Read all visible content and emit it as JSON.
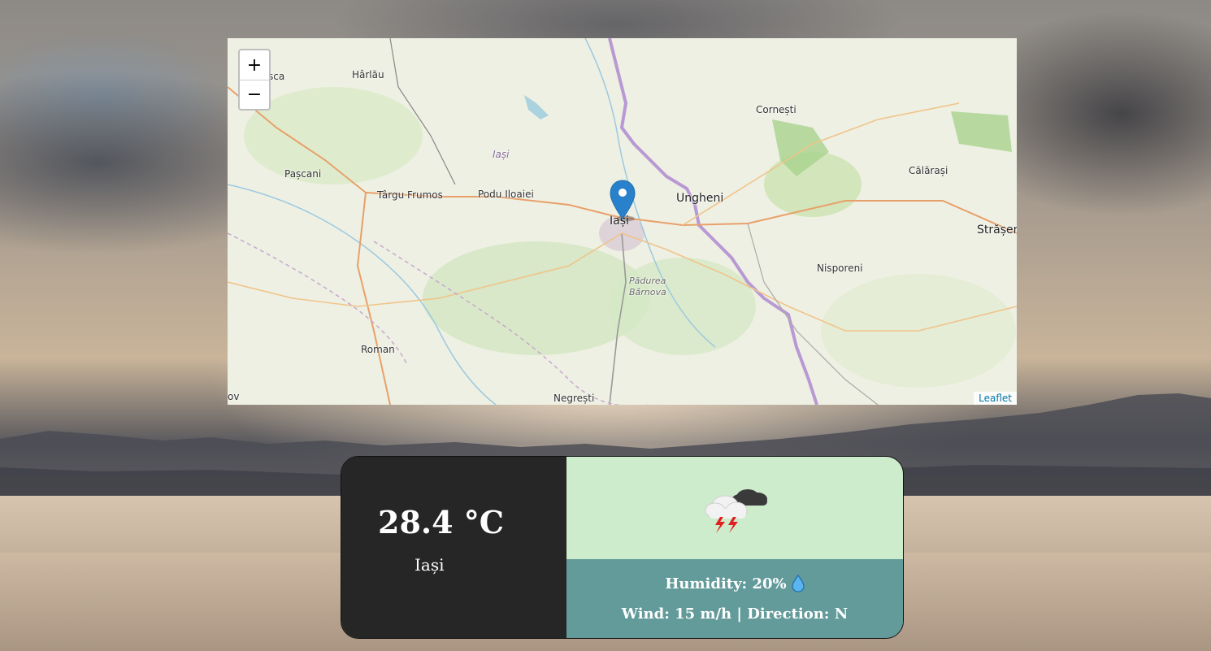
{
  "map": {
    "zoom_in": "+",
    "zoom_out": "−",
    "attribution": "Leaflet",
    "places": {
      "harlau": "Hârlău",
      "fragment_top_left": "sca",
      "pascani": "Pașcani",
      "targu_frumos": "Târgu Frumos",
      "podu_iloaiei": "Podu Iloaiei",
      "iasi_county": "Iași",
      "iasi": "Iași",
      "ungheni": "Ungheni",
      "padurea": "Pădurea",
      "barnova": "Bârnova",
      "cornesti": "Cornești",
      "calarasi": "Călărași",
      "straseni": "Strășen",
      "nisporeni": "Nisporeni",
      "roman": "Roman",
      "negresti": "Negrești",
      "fragment_bottom_left": "ov"
    }
  },
  "weather": {
    "temperature": "28.4 °C",
    "city": "Iași",
    "icon": "thunderstorm-cloud-icon",
    "humidity": "Humidity: 20%",
    "humidity_icon": "water-drop-icon",
    "wind": "Wind: 15 m/h | Direction: N"
  }
}
